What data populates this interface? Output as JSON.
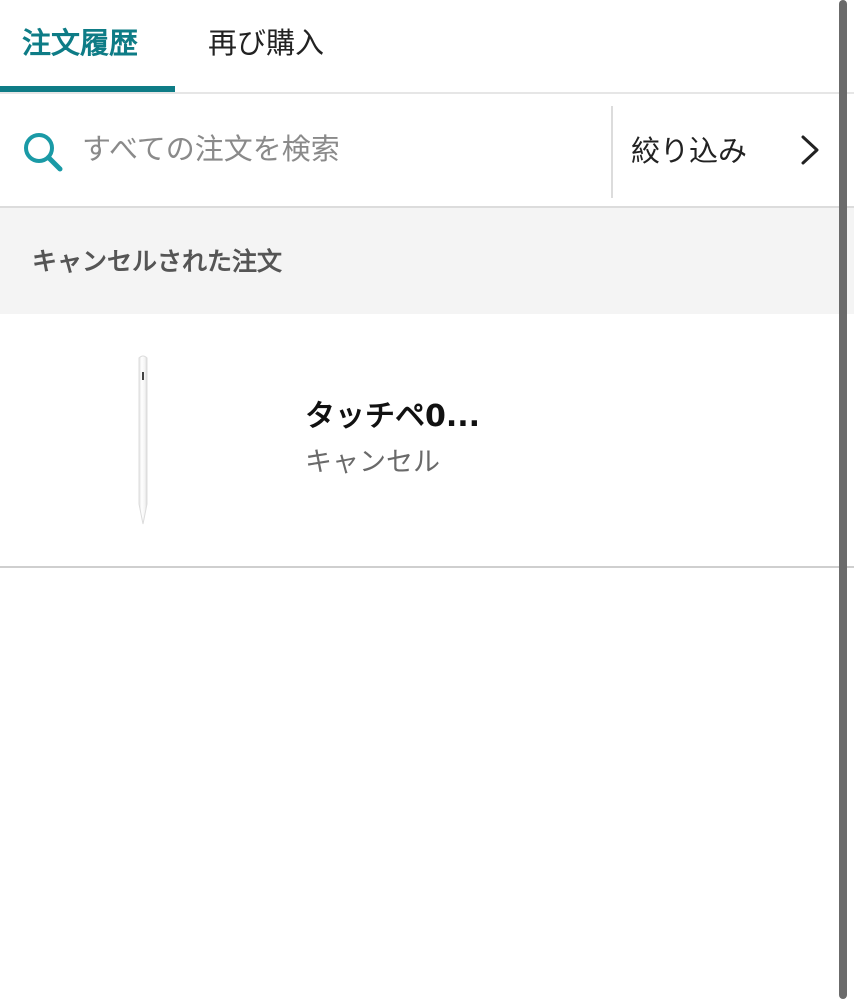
{
  "tabs": {
    "order_history": "注文履歴",
    "buy_again": "再び購入"
  },
  "search": {
    "placeholder": "すべての注文を検索",
    "value": "",
    "filter_label": "絞り込み"
  },
  "section": {
    "title": "キャンセルされた注文"
  },
  "orders": [
    {
      "name": "タッチペ0...",
      "status": "キャンセル"
    }
  ],
  "colors": {
    "accent": "#0e7c86",
    "search_icon": "#1a9aa6",
    "section_bg": "#f4f4f4"
  },
  "icons": {
    "search": "search-icon",
    "filter_chevron": "chevron-right-icon",
    "product": "stylus-pen-image"
  }
}
